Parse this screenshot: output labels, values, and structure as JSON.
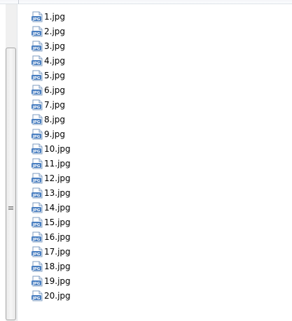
{
  "files": [
    {
      "name": "1.jpg",
      "icon": "jpg-file-icon"
    },
    {
      "name": "2.jpg",
      "icon": "jpg-file-icon"
    },
    {
      "name": "3.jpg",
      "icon": "jpg-file-icon"
    },
    {
      "name": "4.jpg",
      "icon": "jpg-file-icon"
    },
    {
      "name": "5.jpg",
      "icon": "jpg-file-icon"
    },
    {
      "name": "6.jpg",
      "icon": "jpg-file-icon"
    },
    {
      "name": "7.jpg",
      "icon": "jpg-file-icon"
    },
    {
      "name": "8.jpg",
      "icon": "jpg-file-icon"
    },
    {
      "name": "9.jpg",
      "icon": "jpg-file-icon"
    },
    {
      "name": "10.jpg",
      "icon": "jpg-file-icon"
    },
    {
      "name": "11.jpg",
      "icon": "jpg-file-icon"
    },
    {
      "name": "12.jpg",
      "icon": "jpg-file-icon"
    },
    {
      "name": "13.jpg",
      "icon": "jpg-file-icon"
    },
    {
      "name": "14.jpg",
      "icon": "jpg-file-icon"
    },
    {
      "name": "15.jpg",
      "icon": "jpg-file-icon"
    },
    {
      "name": "16.jpg",
      "icon": "jpg-file-icon"
    },
    {
      "name": "17.jpg",
      "icon": "jpg-file-icon"
    },
    {
      "name": "18.jpg",
      "icon": "jpg-file-icon"
    },
    {
      "name": "19.jpg",
      "icon": "jpg-file-icon"
    },
    {
      "name": "20.jpg",
      "icon": "jpg-file-icon"
    }
  ],
  "colors": {
    "icon_blue": "#4a7fc1",
    "icon_light": "#dce9f8",
    "scroll_thumb_border": "#a7a7a7"
  }
}
